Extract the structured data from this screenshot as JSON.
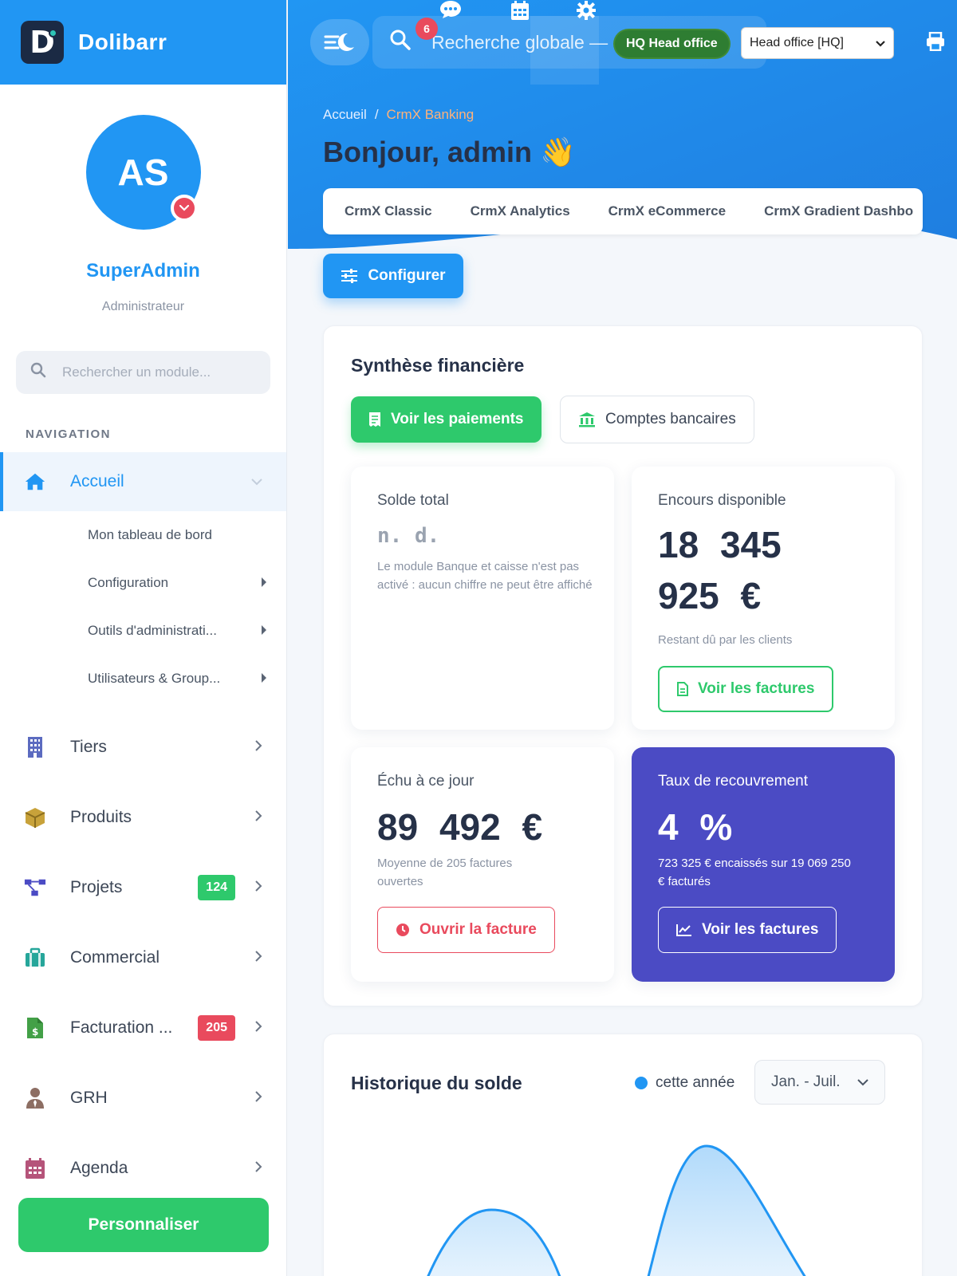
{
  "app": {
    "name": "Dolibarr",
    "logo_letter": "D"
  },
  "profile": {
    "initials": "AS",
    "name": "SuperAdmin",
    "role": "Administrateur"
  },
  "module_search": {
    "placeholder": "Rechercher un module..."
  },
  "nav": {
    "title": "NAVIGATION",
    "active": {
      "label": "Accueil",
      "icon": "home-icon"
    },
    "sub_items": [
      {
        "label": "Mon tableau de bord"
      },
      {
        "label": "Configuration"
      },
      {
        "label": "Outils d'administrati..."
      },
      {
        "label": "Utilisateurs & Group..."
      }
    ],
    "items": [
      {
        "label": "Tiers",
        "icon": "building-icon",
        "color": "#5c6bc0"
      },
      {
        "label": "Produits",
        "icon": "box-icon",
        "color": "#c8a23a"
      },
      {
        "label": "Projets",
        "icon": "project-tree-icon",
        "color": "#4b4bc4",
        "badge": "124",
        "badge_color": "#2ec96c"
      },
      {
        "label": "Commercial",
        "icon": "briefcase-icon",
        "color": "#26a69a"
      },
      {
        "label": "Facturation ...",
        "icon": "invoice-icon",
        "color": "#43a047",
        "badge": "205",
        "badge_color": "#e94a5d"
      },
      {
        "label": "GRH",
        "icon": "person-tie-icon",
        "color": "#8d6e63"
      },
      {
        "label": "Agenda",
        "icon": "calendar-icon",
        "color": "#b5547a"
      }
    ],
    "personalize": "Personnaliser"
  },
  "topbar": {
    "search_placeholder": "Recherche globale — c",
    "notif_count": "6",
    "hq_pill": "HQ Head office",
    "entity_select": "Head office [HQ]"
  },
  "breadcrumb": {
    "home": "Accueil",
    "sep": "/",
    "current": "CrmX Banking"
  },
  "greeting": "Bonjour, admin 👋",
  "tabs": [
    "CrmX Classic",
    "CrmX Analytics",
    "CrmX eCommerce",
    "CrmX Gradient Dashbo"
  ],
  "configure_button": "Configurer",
  "financial": {
    "title": "Synthèse financière",
    "payments_button": "Voir les paiements",
    "accounts_button": "Comptes bancaires",
    "cards": {
      "balance": {
        "title": "Solde total",
        "value": "n. d.",
        "note": "Le module Banque et caisse n'est pas activé : aucun chiffre ne peut être affiché"
      },
      "outstanding": {
        "title": "Encours disponible",
        "value_line1": "18 345",
        "value_line2": "925 €",
        "note": "Restant dû par les clients",
        "button": "Voir les factures"
      },
      "due": {
        "title": "Échu à ce jour",
        "value": "89 492 €",
        "note": "Moyenne de 205 factures ouvertes",
        "button": "Ouvrir la facture"
      },
      "recovery": {
        "title": "Taux de recouvrement",
        "value": "4 %",
        "note": "723 325 € encaissés sur 19 069 250 € facturés",
        "button": "Voir les factures"
      }
    }
  },
  "history": {
    "title": "Historique du solde",
    "legend": "cette année",
    "range": "Jan. - Juil."
  },
  "colors": {
    "primary": "#2196f3",
    "success": "#2ec96c",
    "danger": "#e94a5d",
    "purple": "#4b4bc4"
  }
}
